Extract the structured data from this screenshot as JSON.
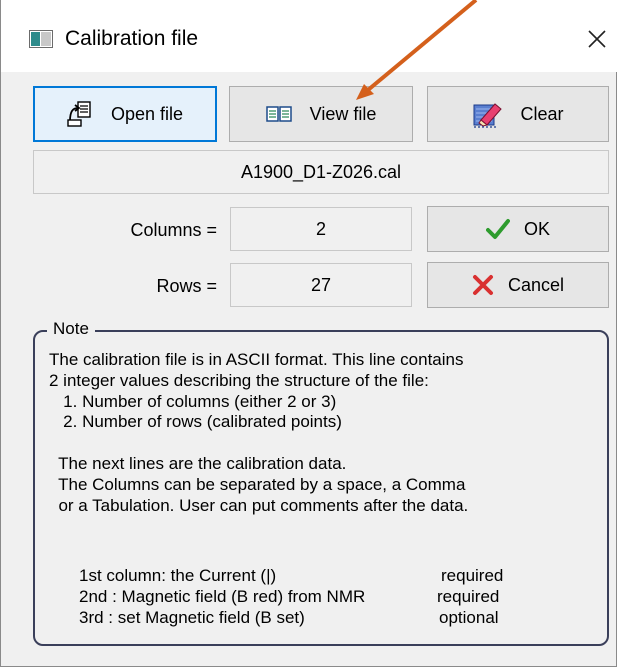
{
  "window": {
    "title": "Calibration file",
    "close_symbol": "✕"
  },
  "toolbar": {
    "open_label": "Open file",
    "view_label": "View file",
    "clear_label": "Clear"
  },
  "file": {
    "name": "A1900_D1-Z026.cal"
  },
  "fields": {
    "columns_label": "Columns =",
    "columns_value": "2",
    "rows_label": "Rows =",
    "rows_value": "27"
  },
  "actions": {
    "ok_label": "OK",
    "cancel_label": "Cancel"
  },
  "note": {
    "legend": "Note",
    "lines": [
      "The calibration file is in ASCII format. This line contains",
      "2 integer values describing the structure of the file:",
      "   1. Number of columns (either 2 or 3)",
      "   2. Number of rows (calibrated points)",
      "",
      "  The next lines are the calibration data.",
      "  The Columns can be separated by a space, a Comma",
      "  or a Tabulation. User can put comments after the data."
    ],
    "columns": [
      {
        "desc": "1st column: the Current (|)",
        "status": "required"
      },
      {
        "desc": "2nd : Magnetic field (B red) from NMR",
        "status": "required"
      },
      {
        "desc": "3rd : set Magnetic field (B set)",
        "status": "optional"
      }
    ]
  },
  "colors": {
    "accent": "#0078d7",
    "ok_check": "#2e9c2e",
    "cancel_x": "#d93030",
    "annotation_arrow": "#d4601c"
  }
}
